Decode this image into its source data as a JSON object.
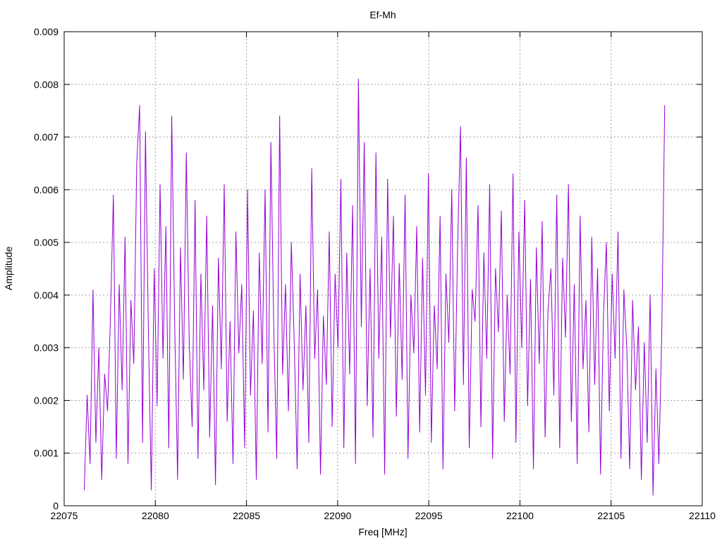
{
  "chart_data": {
    "type": "line",
    "title": "Ef-Mh",
    "xlabel": "Freq [MHz]",
    "ylabel": "Amplitude",
    "xlim": [
      22075,
      22110
    ],
    "ylim": [
      0,
      0.009
    ],
    "grid": true,
    "legend": "none",
    "xticks": [
      "22075",
      "22080",
      "22085",
      "22090",
      "22095",
      "22100",
      "22105",
      "22110"
    ],
    "yticks": [
      "0",
      "0.001",
      "0.002",
      "0.003",
      "0.004",
      "0.005",
      "0.006",
      "0.007",
      "0.008",
      "0.009"
    ],
    "series": [
      {
        "name": "Ef-Mh",
        "color": "#9400d3",
        "x_start": 22076.1,
        "x_step": 0.16,
        "values": [
          0.0003,
          0.0021,
          0.0008,
          0.0041,
          0.0012,
          0.003,
          0.0005,
          0.0025,
          0.0018,
          0.0036,
          0.0059,
          0.0009,
          0.0042,
          0.0022,
          0.0051,
          0.0008,
          0.0039,
          0.0027,
          0.0065,
          0.0076,
          0.0012,
          0.0071,
          0.0033,
          0.0003,
          0.0045,
          0.0019,
          0.0061,
          0.0028,
          0.0053,
          0.0011,
          0.0074,
          0.0035,
          0.0005,
          0.0049,
          0.0024,
          0.0067,
          0.0031,
          0.0015,
          0.0058,
          0.0009,
          0.0044,
          0.0022,
          0.0055,
          0.0013,
          0.0038,
          0.0004,
          0.0047,
          0.0026,
          0.0061,
          0.0016,
          0.0035,
          0.0008,
          0.0052,
          0.0029,
          0.0042,
          0.0011,
          0.006,
          0.0021,
          0.0037,
          0.0005,
          0.0048,
          0.0027,
          0.006,
          0.0014,
          0.0069,
          0.0033,
          0.0009,
          0.0074,
          0.0025,
          0.0042,
          0.0018,
          0.005,
          0.0031,
          0.0007,
          0.0044,
          0.0022,
          0.0038,
          0.0012,
          0.0064,
          0.0028,
          0.0041,
          0.0006,
          0.0036,
          0.0023,
          0.0052,
          0.0015,
          0.0044,
          0.003,
          0.0062,
          0.0011,
          0.0048,
          0.0025,
          0.0057,
          0.0008,
          0.0081,
          0.0034,
          0.0069,
          0.0019,
          0.0045,
          0.0013,
          0.0067,
          0.0028,
          0.0051,
          0.0006,
          0.0062,
          0.0032,
          0.0055,
          0.0017,
          0.0046,
          0.0024,
          0.0059,
          0.0009,
          0.004,
          0.0029,
          0.0053,
          0.0014,
          0.0047,
          0.0021,
          0.0063,
          0.0012,
          0.0038,
          0.0026,
          0.0055,
          0.0007,
          0.0044,
          0.0031,
          0.006,
          0.0018,
          0.0049,
          0.0072,
          0.0023,
          0.0066,
          0.0011,
          0.0041,
          0.0035,
          0.0057,
          0.0015,
          0.0048,
          0.0028,
          0.0061,
          0.0009,
          0.0045,
          0.0033,
          0.0056,
          0.0016,
          0.004,
          0.0025,
          0.0063,
          0.0012,
          0.0052,
          0.003,
          0.0058,
          0.0019,
          0.0043,
          0.0007,
          0.0049,
          0.0027,
          0.0054,
          0.0013,
          0.0037,
          0.0045,
          0.0021,
          0.0059,
          0.0011,
          0.0047,
          0.0032,
          0.0061,
          0.0016,
          0.0042,
          0.0008,
          0.0055,
          0.0026,
          0.0039,
          0.0014,
          0.0051,
          0.0023,
          0.0045,
          0.0006,
          0.0036,
          0.005,
          0.0018,
          0.0044,
          0.0028,
          0.0052,
          0.0009,
          0.0041,
          0.003,
          0.0007,
          0.0039,
          0.0022,
          0.0034,
          0.0005,
          0.0031,
          0.0012,
          0.004,
          0.0002,
          0.0026,
          0.0008,
          0.0033,
          0.0076
        ]
      }
    ]
  }
}
